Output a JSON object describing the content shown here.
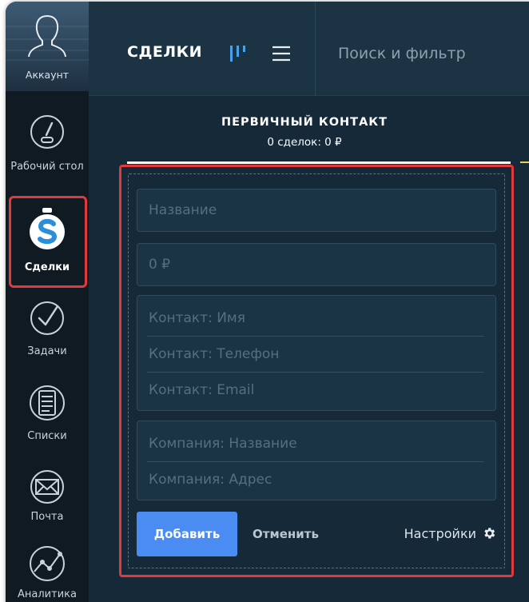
{
  "sidebar": {
    "account_label": "Аккаунт",
    "items": [
      {
        "label": "Рабочий стол",
        "icon": "dashboard-gauge-icon"
      },
      {
        "label": "Сделки",
        "icon": "deals-money-bag-icon",
        "active": true
      },
      {
        "label": "Задачи",
        "icon": "tasks-check-icon"
      },
      {
        "label": "Списки",
        "icon": "lists-document-icon"
      },
      {
        "label": "Почта",
        "icon": "mail-envelope-icon"
      },
      {
        "label": "Аналитика",
        "icon": "analytics-graph-icon"
      }
    ]
  },
  "header": {
    "title": "СДЕЛКИ",
    "search_placeholder": "Поиск и фильтр"
  },
  "column": {
    "title": "ПЕРВИЧНЫЙ КОНТАКТ",
    "summary": "0 сделок: 0 ₽"
  },
  "form": {
    "name_placeholder": "Название",
    "amount_placeholder": "0 ₽",
    "contact_name_placeholder": "Контакт: Имя",
    "contact_phone_placeholder": "Контакт: Телефон",
    "contact_email_placeholder": "Контакт: Email",
    "company_name_placeholder": "Компания: Название",
    "company_address_placeholder": "Компания: Адрес",
    "add_label": "Добавить",
    "cancel_label": "Отменить",
    "settings_label": "Настройки"
  },
  "colors": {
    "accent_button": "#4a8cf2",
    "highlight_outline": "#e23a3a",
    "header_bg": "#1b3343",
    "sidebar_bg": "#0f1a22"
  }
}
